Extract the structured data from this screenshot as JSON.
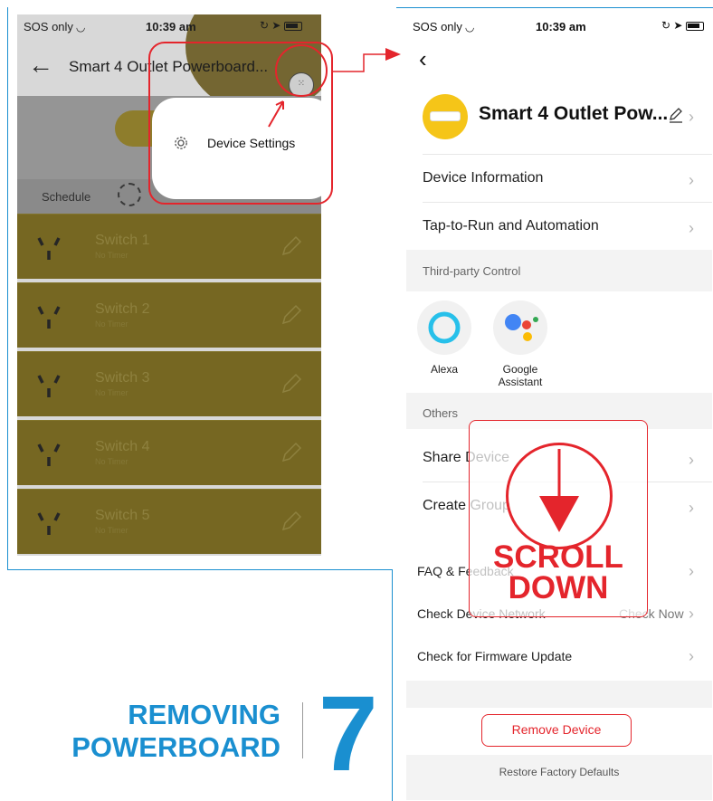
{
  "left_screen": {
    "status": {
      "carrier": "SOS only",
      "time": "10:39 am"
    },
    "header": {
      "title": "Smart 4 Outlet Powerboard..."
    },
    "tabs": {
      "schedule": "Schedule"
    },
    "switches": [
      {
        "name": "Switch 1",
        "timer": "No Timer"
      },
      {
        "name": "Switch 2",
        "timer": "No Timer"
      },
      {
        "name": "Switch 3",
        "timer": "No Timer"
      },
      {
        "name": "Switch 4",
        "timer": "No Timer"
      },
      {
        "name": "Switch 5",
        "timer": "No Timer"
      }
    ],
    "popup": {
      "label": "Device Settings",
      "icon": "gear-icon"
    }
  },
  "right_screen": {
    "status": {
      "carrier": "SOS only",
      "time": "10:39 am"
    },
    "device_name": "Smart 4 Outlet Pow...",
    "rows": {
      "device_information": "Device Information",
      "tap_to_run": "Tap-to-Run and Automation"
    },
    "third_party": {
      "section_label": "Third-party Control",
      "items": [
        {
          "label": "Alexa",
          "icon": "alexa-icon"
        },
        {
          "label": "Google\nAssistant",
          "icon": "google-assistant-icon"
        }
      ]
    },
    "others": {
      "section_label": "Others",
      "share_device": "Share Device",
      "create_group": "Create Group"
    },
    "more": {
      "faq": "FAQ & Feedback",
      "check_network": "Check Device Network",
      "check_now": "Check Now",
      "firmware": "Check for Firmware Update"
    },
    "remove_device": "Remove Device",
    "restore_defaults": "Restore Factory Defaults"
  },
  "overlay": {
    "scroll_text_line1": "SCROLL",
    "scroll_text_line2": "DOWN"
  },
  "step": {
    "title_line1": "REMOVING",
    "title_line2": "POWERBOARD",
    "number": "7"
  },
  "colors": {
    "accent_blue": "#1a8fd0",
    "highlight_red": "#e4252c",
    "device_yellow": "#f5c518"
  }
}
